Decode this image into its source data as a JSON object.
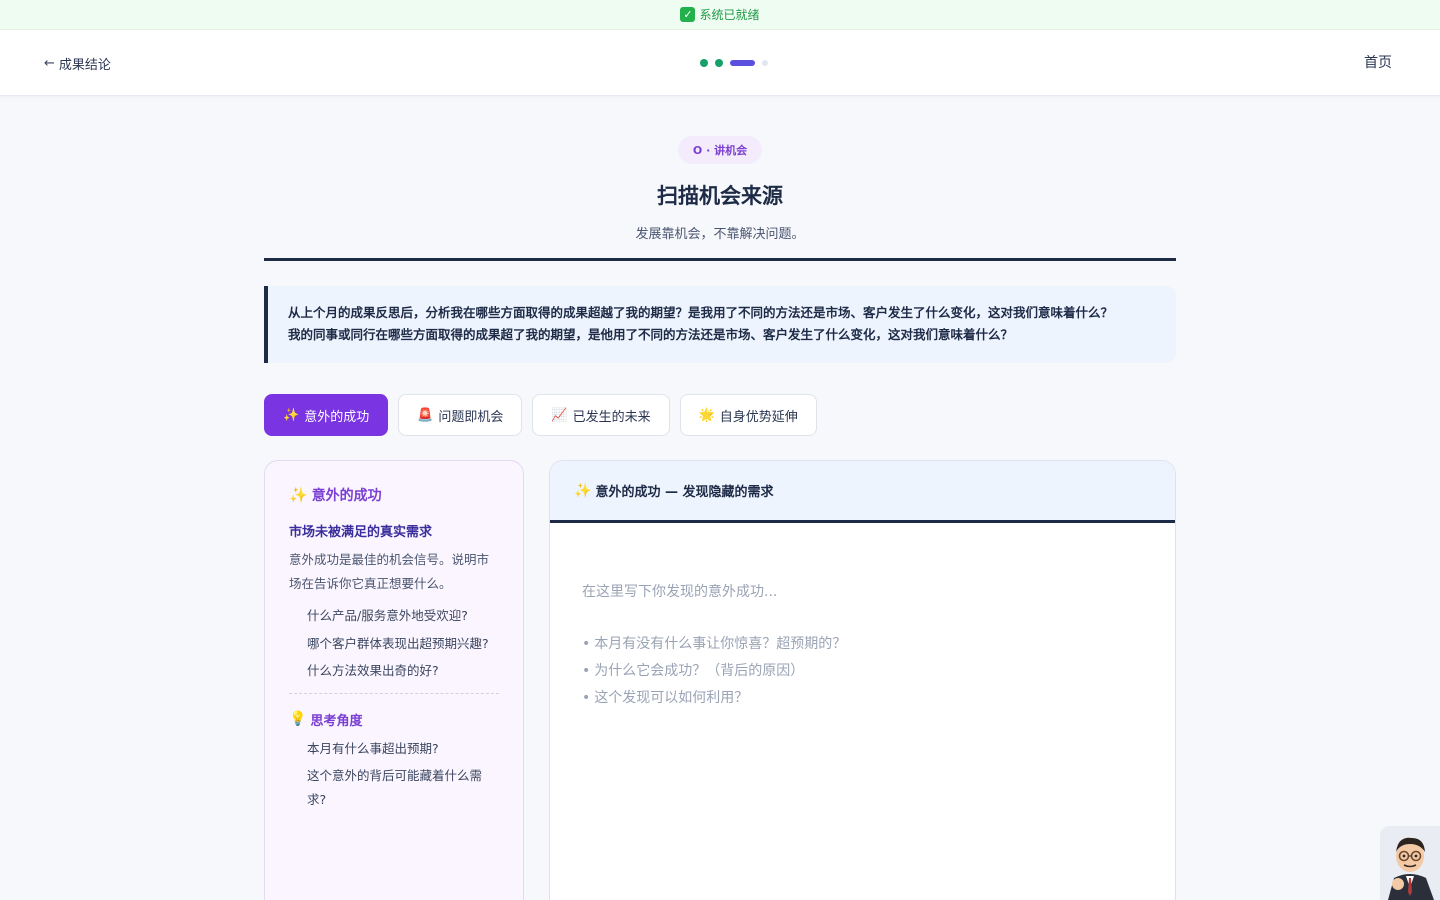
{
  "status": {
    "icon": "check-icon",
    "text": "系统已就绪"
  },
  "header": {
    "back_label": "成果结论",
    "home_label": "首页",
    "steps": [
      "done",
      "done",
      "active",
      "pending"
    ]
  },
  "section": {
    "badge": "O · 讲机会",
    "title": "扫描机会来源",
    "subtitle": "发展靠机会，不靠解决问题。"
  },
  "prompt": {
    "lines": [
      "从上个月的成果反思后，分析我在哪些方面取得的成果超越了我的期望？是我用了不同的方法还是市场、客户发生了什么变化，这对我们意味着什么？",
      "我的同事或同行在哪些方面取得的成果超了我的期望，是他用了不同的方法还是市场、客户发生了什么变化，这对我们意味着什么？"
    ]
  },
  "tabs": [
    {
      "icon": "✨",
      "label": "意外的成功",
      "active": true
    },
    {
      "icon": "🚨",
      "label": "问题即机会",
      "active": false
    },
    {
      "icon": "📈",
      "label": "已发生的未来",
      "active": false
    },
    {
      "icon": "🌟",
      "label": "自身优势延伸",
      "active": false
    }
  ],
  "info_card": {
    "icon": "✨",
    "heading": "意外的成功",
    "subheading": "市场未被满足的真实需求",
    "description": "意外成功是最佳的机会信号。说明市场在告诉你它真正想要什么。",
    "questions": [
      "什么产品/服务意外地受欢迎?",
      "哪个客户群体表现出超预期兴趣?",
      "什么方法效果出奇的好?"
    ],
    "angle_icon": "💡",
    "angle_heading": "思考角度",
    "angles": [
      "本月有什么事超出预期?",
      "这个意外的背后可能藏着什么需求?"
    ]
  },
  "editor": {
    "header_icon": "✨",
    "header": "意外的成功 — 发现隐藏的需求",
    "placeholder": "在这里写下你发现的意外成功...",
    "hints": [
      "本月有没有什么事让你惊喜？超预期的？",
      "为什么它会成功？（背后的原因）",
      "这个发现可以如何利用？"
    ]
  },
  "colors": {
    "accent": "#7a34e2",
    "navy": "#1e2b47",
    "success": "#16a06a",
    "step_active": "#5b4fe0"
  }
}
